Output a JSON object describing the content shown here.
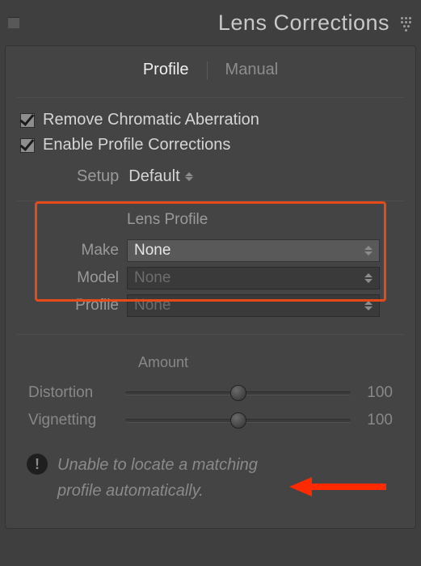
{
  "panel": {
    "title": "Lens Corrections"
  },
  "tabs": {
    "profile": "Profile",
    "manual": "Manual",
    "active": "profile"
  },
  "checks": {
    "chroma_label": "Remove Chromatic Aberration",
    "enable_label": "Enable Profile Corrections"
  },
  "setup": {
    "label": "Setup",
    "value": "Default"
  },
  "lens_profile": {
    "title": "Lens Profile",
    "make_label": "Make",
    "make_value": "None",
    "model_label": "Model",
    "model_value": "None",
    "profile_label": "Profile",
    "profile_value": "None"
  },
  "amount": {
    "title": "Amount",
    "distortion_label": "Distortion",
    "distortion_value": "100",
    "vignetting_label": "Vignetting",
    "vignetting_value": "100"
  },
  "warning": {
    "text": "Unable to locate a matching profile automatically."
  },
  "colors": {
    "highlight": "#e64a19"
  }
}
